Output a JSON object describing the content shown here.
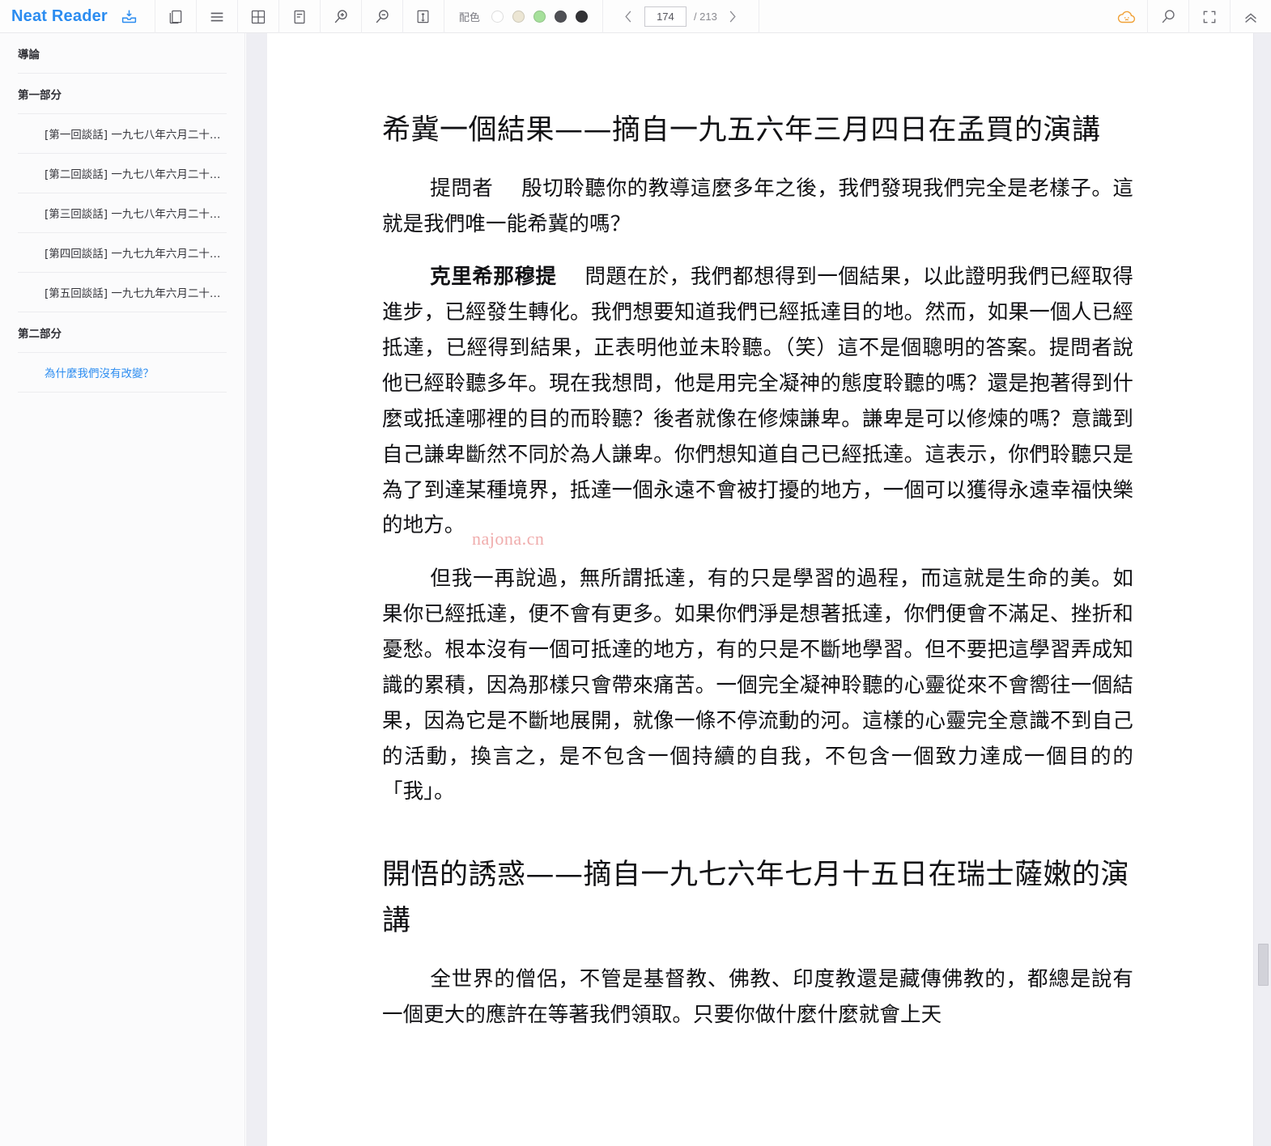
{
  "app": {
    "brand": "Neat Reader",
    "brand_color": "#2b8cf0"
  },
  "toolbar": {
    "icons": [
      {
        "name": "save-to-device-icon",
        "title": "保存"
      },
      {
        "name": "two-page-view-icon",
        "title": "双页"
      },
      {
        "name": "menu-lines-icon",
        "title": "目录"
      },
      {
        "name": "grid-view-icon",
        "title": "网格"
      },
      {
        "name": "text-layout-icon",
        "title": "排版"
      },
      {
        "name": "zoom-in-icon",
        "title": "放大"
      },
      {
        "name": "zoom-out-icon",
        "title": "缩小"
      },
      {
        "name": "line-height-icon",
        "title": "行距"
      }
    ],
    "palette_label": "配色",
    "palette_swatches": [
      {
        "name": "theme-white",
        "color": "#ffffff",
        "selected": false
      },
      {
        "name": "theme-sepia",
        "color": "#ece6d4",
        "selected": false
      },
      {
        "name": "theme-green",
        "color": "#a6e09b",
        "selected": false
      },
      {
        "name": "theme-dark-gray",
        "color": "#4f5055",
        "selected": false
      },
      {
        "name": "theme-black",
        "color": "#333336",
        "selected": false
      }
    ],
    "pager": {
      "prev": "‹",
      "next": "›",
      "current_page": "174",
      "total_label": "/ 213",
      "total_pages": "213"
    },
    "right_icons": [
      {
        "name": "cloud-sync-icon",
        "title": "云同步",
        "color": "#f0a035"
      },
      {
        "name": "search-icon",
        "title": "搜索"
      },
      {
        "name": "fullscreen-icon",
        "title": "全屏"
      },
      {
        "name": "collapse-toolbar-icon",
        "title": "收起"
      }
    ]
  },
  "sidebar": {
    "items": [
      {
        "label": "導論",
        "level": 0,
        "active": false
      },
      {
        "label": "第一部分",
        "level": 0,
        "active": false
      },
      {
        "label": "[第一回談話] 一九七八年六月二十…",
        "level": 1,
        "active": false
      },
      {
        "label": "[第二回談話] 一九七八年六月二十…",
        "level": 1,
        "active": false
      },
      {
        "label": "[第三回談話] 一九七八年六月二十…",
        "level": 1,
        "active": false
      },
      {
        "label": "[第四回談話] 一九七九年六月二十…",
        "level": 1,
        "active": false
      },
      {
        "label": "[第五回談話] 一九七九年六月二十…",
        "level": 1,
        "active": false
      },
      {
        "label": "第二部分",
        "level": 0,
        "active": false
      },
      {
        "label": "為什麼我們沒有改變？",
        "level": 1,
        "active": true
      }
    ]
  },
  "content": {
    "heading1": "希冀一個結果——摘自一九五六年三月四日在孟買的演講",
    "p1_speaker": "提問者",
    "p1_text": "殷切聆聽你的教導這麼多年之後，我們發現我們完全是老樣子。這就是我們唯一能希冀的嗎？",
    "p2_speaker": "克里希那穆提",
    "p2_text": "問題在於，我們都想得到一個結果，以此證明我們已經取得進步，已經發生轉化。我們想要知道我們已經抵達目的地。然而，如果一個人已經抵達，已經得到結果，正表明他並未聆聽。（笑）這不是個聰明的答案。提問者說他已經聆聽多年。現在我想問，他是用完全凝神的態度聆聽的嗎？還是抱著得到什麼或抵達哪裡的目的而聆聽？後者就像在修煉謙卑。謙卑是可以修煉的嗎？意識到自己謙卑斷然不同於為人謙卑。你們想知道自己已經抵達。這表示，你們聆聽只是為了到達某種境界，抵達一個永遠不會被打擾的地方，一個可以獲得永遠幸福快樂的地方。",
    "p3_text": "但我一再說過，無所謂抵達，有的只是學習的過程，而這就是生命的美。如果你已經抵達，便不會有更多。如果你們淨是想著抵達，你們便會不滿足、挫折和憂愁。根本沒有一個可抵達的地方，有的只是不斷地學習。但不要把這學習弄成知識的累積，因為那樣只會帶來痛苦。一個完全凝神聆聽的心靈從來不會嚮往一個結果，因為它是不斷地展開，就像一條不停流動的河。這樣的心靈完全意識不到自己的活動，換言之，是不包含一個持續的自我，不包含一個致力達成一個目的的「我」。",
    "heading2": "開悟的誘惑——摘自一九七六年七月十五日在瑞士薩嫩的演講",
    "p4_text": "全世界的僧侶，不管是基督教、佛教、印度教還是藏傳佛教的，都總是說有一個更大的應許在等著我們領取。只要你做什麼什麼就會上天",
    "watermark": "najona.cn"
  }
}
